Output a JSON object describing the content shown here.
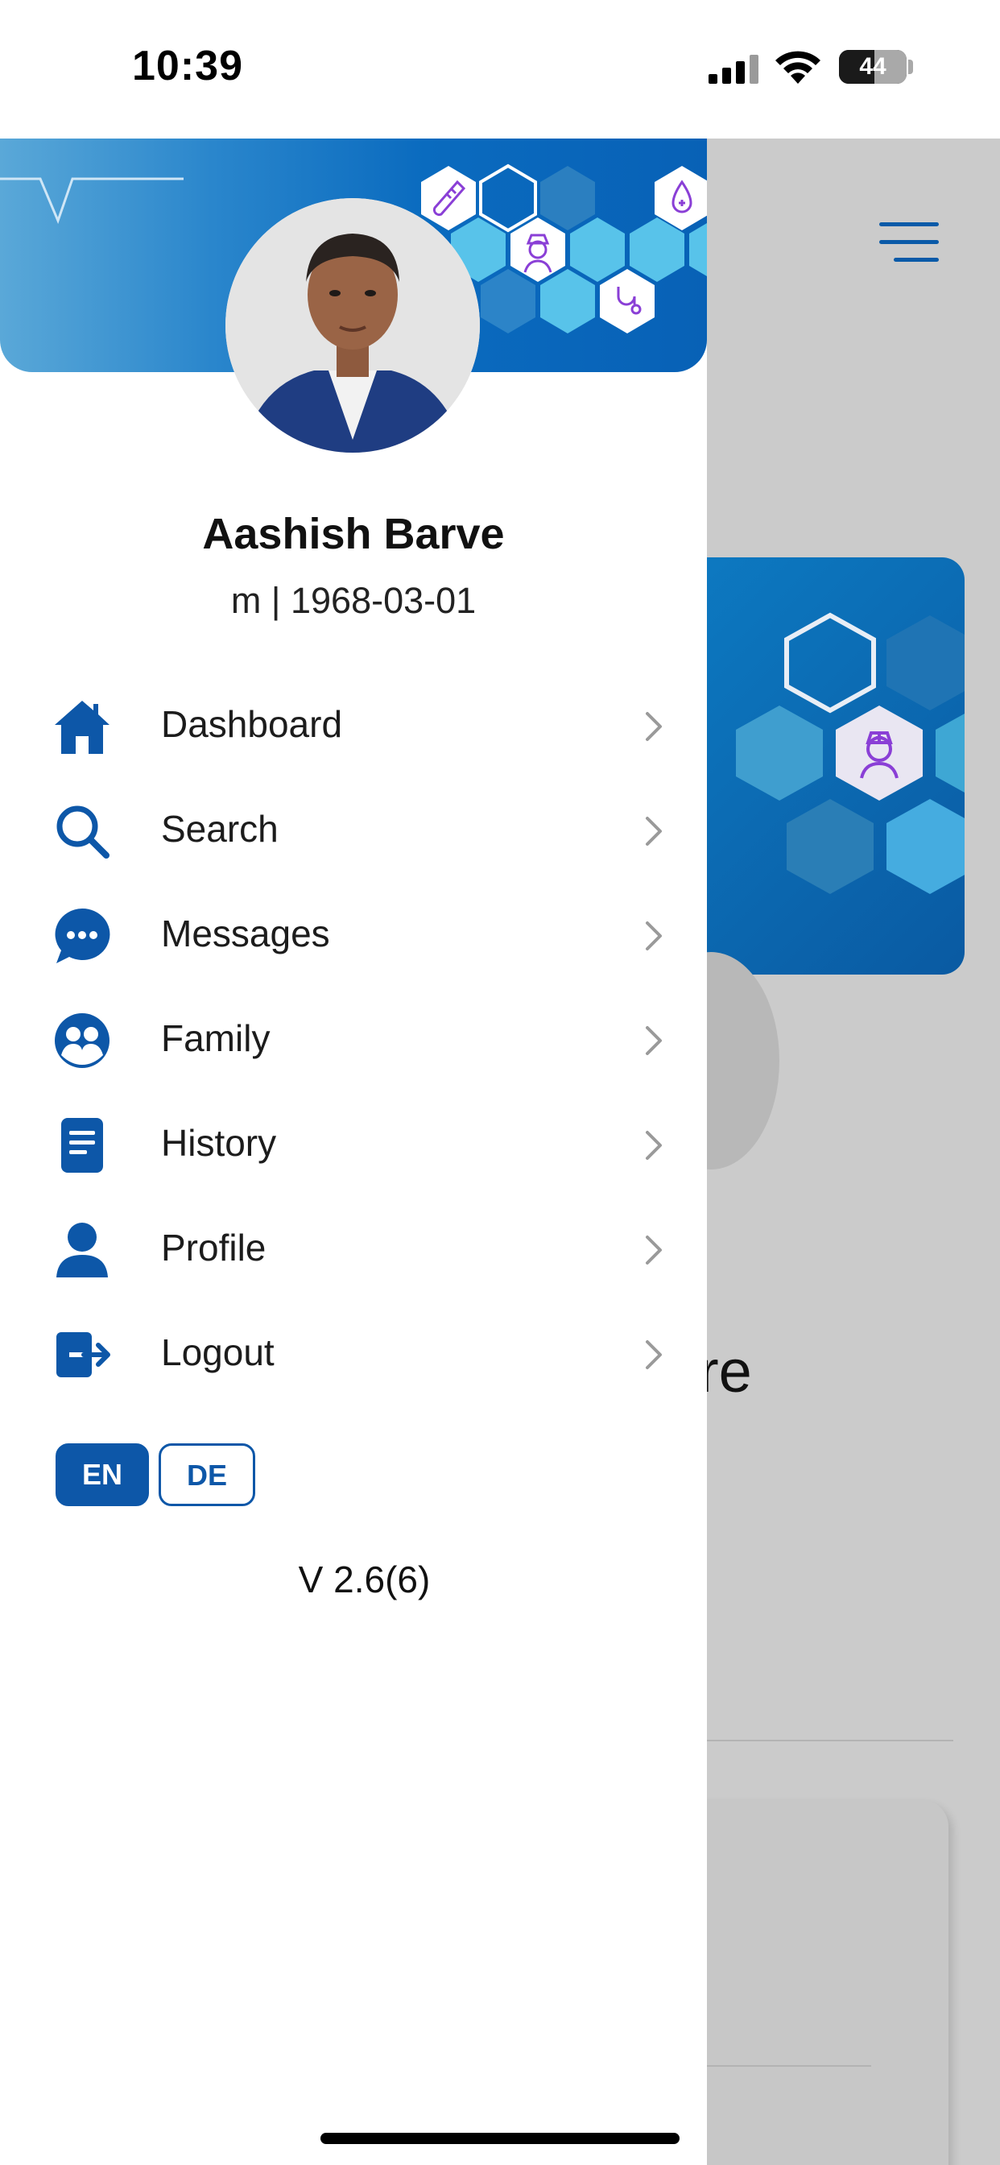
{
  "status_bar": {
    "time": "10:39",
    "battery": "44",
    "battery_level_pct": 44
  },
  "drawer": {
    "user": {
      "name": "Aashish Barve",
      "meta": "m | 1968-03-01"
    },
    "menu": [
      {
        "label": "Dashboard",
        "icon": "home-icon"
      },
      {
        "label": "Search",
        "icon": "search-icon"
      },
      {
        "label": "Messages",
        "icon": "chat-bubble-icon"
      },
      {
        "label": "Family",
        "icon": "family-icon"
      },
      {
        "label": "History",
        "icon": "document-icon"
      },
      {
        "label": "Profile",
        "icon": "person-icon"
      },
      {
        "label": "Logout",
        "icon": "logout-icon"
      }
    ],
    "languages": [
      {
        "code": "EN",
        "active": true
      },
      {
        "code": "DE",
        "active": false
      }
    ],
    "version": "V 2.6(6)"
  },
  "background_app": {
    "partial_text": "re"
  },
  "colors": {
    "accent": "#0d57a8",
    "banner_start": "#5aa8d8",
    "banner_end": "#0861b6",
    "overlay": "#cbcbcb"
  }
}
